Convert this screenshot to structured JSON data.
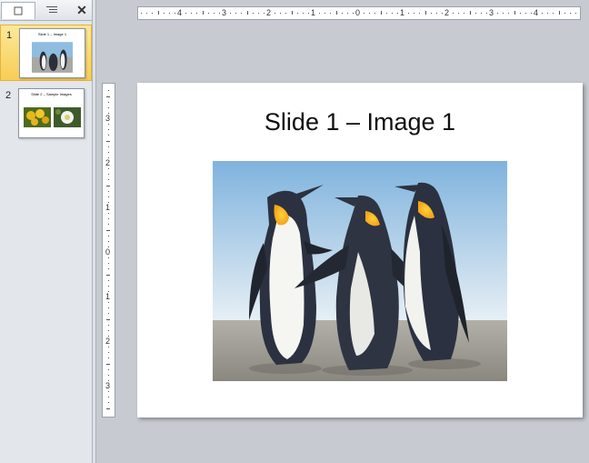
{
  "pane": {
    "tabs": [
      {
        "name": "slides",
        "icon": "slides-tab-icon"
      },
      {
        "name": "outline",
        "icon": "outline-tab-icon"
      }
    ],
    "close_glyph": "✕"
  },
  "slides": [
    {
      "number": "1",
      "title": "Slide 1 – Image 1",
      "selected": true,
      "images": [
        "penguins"
      ]
    },
    {
      "number": "2",
      "title": "Slide 2 – Sample Images",
      "selected": false,
      "images": [
        "yellow-flowers",
        "white-flower"
      ]
    }
  ],
  "rulers": {
    "horizontal": [
      "4",
      "3",
      "2",
      "1",
      "0",
      "1",
      "2",
      "3",
      "4"
    ],
    "vertical": [
      "3",
      "2",
      "1",
      "0",
      "1",
      "2",
      "3"
    ]
  },
  "current_slide": {
    "title": "Slide 1 – Image 1",
    "image": "penguins-photo"
  },
  "colors": {
    "selected_thumb": "#f7cd55",
    "workspace": "#c7cbd1"
  }
}
